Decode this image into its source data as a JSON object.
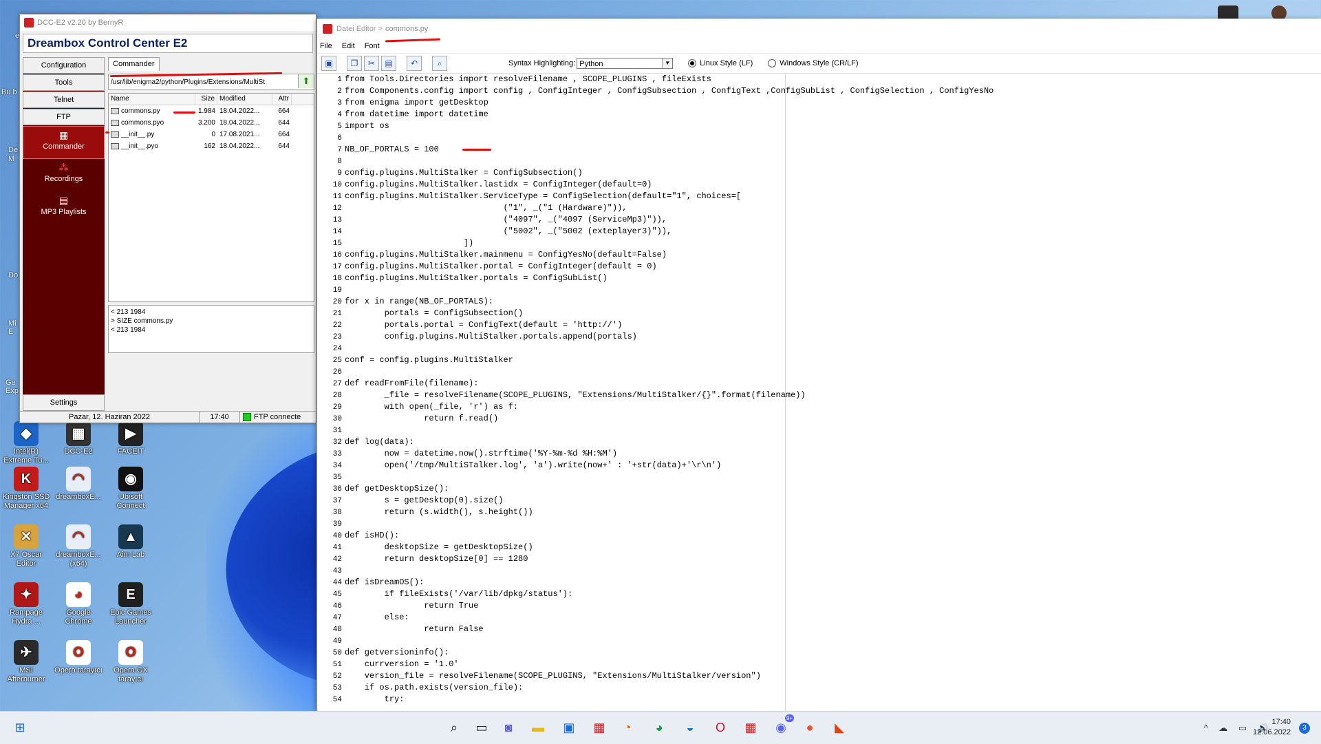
{
  "desktop": {
    "edge_labels": [
      "e",
      "Bu b",
      "De M",
      "Do",
      "Mi E",
      "Ge Exp"
    ],
    "icons": [
      {
        "label": "Intel(R) Extreme Tu...",
        "icon": "intel-icon",
        "color": "#1c64c8",
        "glyph": "◆"
      },
      {
        "label": "DCC-E2",
        "icon": "dcc-icon",
        "color": "#333",
        "glyph": "▦"
      },
      {
        "label": "FACEIT",
        "icon": "faceit-icon",
        "color": "#222",
        "glyph": "▶"
      },
      {
        "label": "Kingston SSD Manager x64",
        "icon": "kingston-icon",
        "color": "#c41a1a",
        "glyph": "K"
      },
      {
        "label": "dreamboxE...",
        "icon": "dreambox-edit-icon",
        "color": "#e8eef8",
        "glyph": "◠"
      },
      {
        "label": "Ubisoft Connect",
        "icon": "ubisoft-icon",
        "color": "#111",
        "glyph": "◉"
      },
      {
        "label": "X7 Oscar Editor",
        "icon": "x7-oscar-icon",
        "color": "#d8a23c",
        "glyph": "✕"
      },
      {
        "label": "dreamboxE... (x64)",
        "icon": "dreambox-edit-x64-icon",
        "color": "#e8eef8",
        "glyph": "◠"
      },
      {
        "label": "Aim Lab",
        "icon": "aimlab-icon",
        "color": "#17384f",
        "glyph": "▲"
      },
      {
        "label": "Rampage Hydra ...",
        "icon": "rampage-hydra-icon",
        "color": "#b01818",
        "glyph": "✦"
      },
      {
        "label": "Google Chrome",
        "icon": "chrome-icon",
        "color": "#fff",
        "glyph": "◕"
      },
      {
        "label": "Epic Games Launcher",
        "icon": "epic-icon",
        "color": "#202020",
        "glyph": "E"
      },
      {
        "label": "MSI Afterburner",
        "icon": "msi-icon",
        "color": "#2a2a2a",
        "glyph": "✈"
      },
      {
        "label": "Opera tarayıcı",
        "icon": "opera-icon",
        "color": "#fff",
        "glyph": "O"
      },
      {
        "label": "Opera GX tarayıcı",
        "icon": "opera-gx-icon",
        "color": "#fff",
        "glyph": "O"
      }
    ]
  },
  "dcc": {
    "title": "DCC-E2 v2.20 by BernyR",
    "banner": "Dreambox Control Center E2",
    "nav": {
      "configuration": "Configuration",
      "tools": "Tools",
      "telnet": "Telnet",
      "ftp": "FTP",
      "commander": "Commander",
      "recordings": "Recordings",
      "mp3": "MP3 Playlists",
      "settings": "Settings"
    },
    "tab": "Commander",
    "path": "/usr/lib/enigma2/python/Plugins/Extensions/MultiSt",
    "columns": {
      "name": "Name",
      "size": "Size",
      "modified": "Modified",
      "attr": "Attr"
    },
    "files": [
      {
        "name": "commons.py",
        "size": "1.984",
        "modified": "18.04.2022...",
        "attr": "664"
      },
      {
        "name": "commons.pyo",
        "size": "3.200",
        "modified": "18.04.2022...",
        "attr": "644"
      },
      {
        "name": "__init__.py",
        "size": "0",
        "modified": "17.08.2021...",
        "attr": "664"
      },
      {
        "name": "__init__.pyo",
        "size": "162",
        "modified": "18.04.2022...",
        "attr": "644"
      }
    ],
    "log": [
      "< 213 1984",
      "> SIZE commons.py",
      "< 213 1984"
    ],
    "status": {
      "date": "Pazar, 12. Haziran 2022",
      "time": "17:40",
      "ftp": "FTP connecte"
    }
  },
  "editor": {
    "title_prefix": "Datei Editor >",
    "title_file": "commons.py",
    "menu": {
      "file": "File",
      "edit": "Edit",
      "font": "Font"
    },
    "toolbar_icons": [
      "save-icon",
      "copy-icon",
      "cut-icon",
      "paste-icon",
      "undo-icon",
      "search-icon"
    ],
    "syntax_label": "Syntax Highlighting:",
    "syntax_value": "Python",
    "radio_linux": "Linux Style (LF)",
    "radio_windows": "Windows Style (CR/LF)",
    "lines": [
      "from Tools.Directories import resolveFilename , SCOPE_PLUGINS , fileExists",
      "from Components.config import config , ConfigInteger , ConfigSubsection , ConfigText ,ConfigSubList , ConfigSelection , ConfigYesNo",
      "from enigma import getDesktop",
      "from datetime import datetime",
      "import os",
      "",
      "NB_OF_PORTALS = 100",
      "",
      "config.plugins.MultiStalker = ConfigSubsection()",
      "config.plugins.MultiStalker.lastidx = ConfigInteger(default=0)",
      "config.plugins.MultiStalker.ServiceType = ConfigSelection(default=\"1\", choices=[",
      "                                (\"1\", _(\"1 (Hardware)\")),",
      "                                (\"4097\", _(\"4097 (ServiceMp3)\")),",
      "                                (\"5002\", _(\"5002 (exteplayer3)\")),",
      "                        ])",
      "config.plugins.MultiStalker.mainmenu = ConfigYesNo(default=False)",
      "config.plugins.MultiStalker.portal = ConfigInteger(default = 0)",
      "config.plugins.MultiStalker.portals = ConfigSubList()",
      "",
      "for x in range(NB_OF_PORTALS):",
      "        portals = ConfigSubsection()",
      "        portals.portal = ConfigText(default = 'http://')",
      "        config.plugins.MultiStalker.portals.append(portals)",
      "",
      "conf = config.plugins.MultiStalker",
      "",
      "def readFromFile(filename):",
      "        _file = resolveFilename(SCOPE_PLUGINS, \"Extensions/MultiStalker/{}\".format(filename))",
      "        with open(_file, 'r') as f:",
      "                return f.read()",
      "",
      "def log(data):",
      "        now = datetime.now().strftime('%Y-%m-%d %H:%M')",
      "        open('/tmp/MultiSTalker.log', 'a').write(now+' : '+str(data)+'\\r\\n')",
      "",
      "def getDesktopSize():",
      "        s = getDesktop(0).size()",
      "        return (s.width(), s.height())",
      "",
      "def isHD():",
      "        desktopSize = getDesktopSize()",
      "        return desktopSize[0] == 1280",
      "",
      "def isDreamOS():",
      "        if fileExists('/var/lib/dpkg/status'):",
      "                return True",
      "        else:",
      "                return False",
      "",
      "def getversioninfo():",
      "    currversion = '1.0'",
      "    version_file = resolveFilename(SCOPE_PLUGINS, \"Extensions/MultiStalker/version\")",
      "    if os.path.exists(version_file):",
      "        try:"
    ]
  },
  "taskbar": {
    "icons": [
      {
        "name": "start-icon",
        "glyph": "⊞",
        "color": "#1a6cd6"
      },
      {
        "name": "search-icon",
        "glyph": "⌕",
        "color": "#222"
      },
      {
        "name": "task-view-icon",
        "glyph": "▭",
        "color": "#222"
      },
      {
        "name": "teams-chat-icon",
        "glyph": "◙",
        "color": "#5b5fc7"
      },
      {
        "name": "file-explorer-icon",
        "glyph": "▬",
        "color": "#e9b528"
      },
      {
        "name": "store-icon",
        "glyph": "▣",
        "color": "#1a6cd6"
      },
      {
        "name": "dcc-taskbar-icon",
        "glyph": "▦",
        "color": "#c22"
      },
      {
        "name": "firefox-icon",
        "glyph": "◔",
        "color": "#e66000"
      },
      {
        "name": "chrome-taskbar-icon",
        "glyph": "◕",
        "color": "#1a9c3e"
      },
      {
        "name": "edge-icon",
        "glyph": "◒",
        "color": "#137dbb"
      },
      {
        "name": "opera-taskbar-icon",
        "glyph": "O",
        "color": "#d5152c"
      },
      {
        "name": "dcc-editor-taskbar-icon",
        "glyph": "▦",
        "color": "#c22"
      },
      {
        "name": "discord-icon",
        "glyph": "◉",
        "color": "#5865f2"
      },
      {
        "name": "maps-icon",
        "glyph": "●",
        "color": "#e8552e"
      },
      {
        "name": "aimp-icon",
        "glyph": "◣",
        "color": "#e8400c"
      }
    ],
    "discord_badge": "9+",
    "tray": "^ ☁ ▭ 🔊",
    "clock_time": "17:40",
    "clock_date": "12.06.2022",
    "notifications": "3"
  }
}
